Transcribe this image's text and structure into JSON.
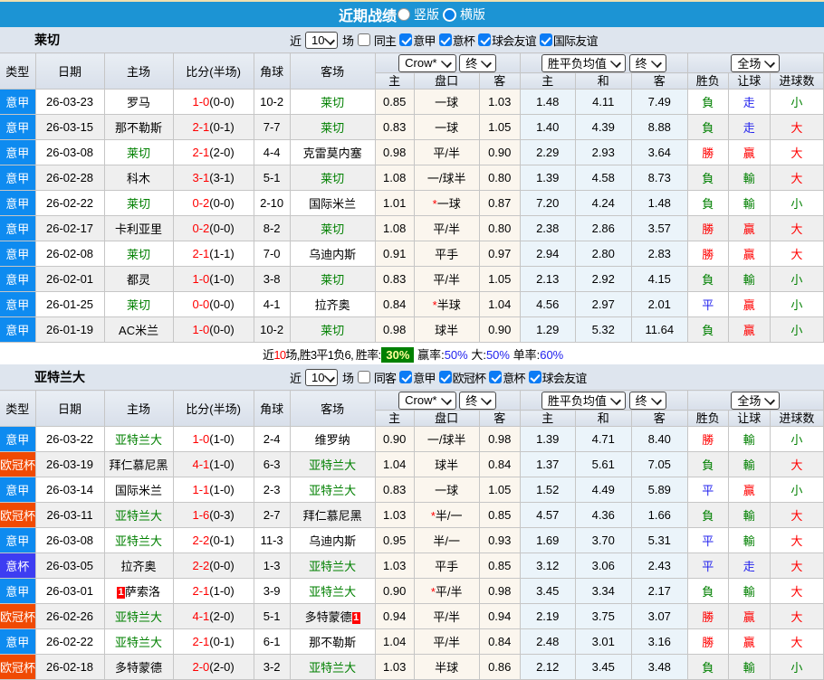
{
  "top_bar": {
    "title": "近期战绩",
    "view_options": [
      {
        "label": "竖版",
        "selected": true
      },
      {
        "label": "横版",
        "selected": false
      }
    ]
  },
  "table_headers": {
    "type": "类型",
    "date": "日期",
    "home": "主场",
    "score": "比分(半场)",
    "corner": "角球",
    "away": "客场",
    "odds_home": "主",
    "handicap": "盘口",
    "odds_away": "客",
    "avg_home": "主",
    "avg_draw": "和",
    "avg_away": "客",
    "result_wdl": "胜负",
    "result_handicap": "让球",
    "result_goals": "进球数"
  },
  "selects": {
    "company": "Crow*",
    "company_final": "终",
    "avg_name": "胜平负均值",
    "avg_final": "终",
    "scope": "全场"
  },
  "filter_labels": {
    "near": "近",
    "games": "场"
  },
  "type_colors": {
    "意甲": "#0E8BF0",
    "欧冠杯": "#F04A03",
    "意杯": "#3D3DF2"
  },
  "result_colors": {
    "勝": "#FF0000",
    "負": "#008000",
    "平": "#2222EE",
    "贏": "#FF0000",
    "輸": "#008000",
    "走": "#2222EE",
    "大": "#FF0000",
    "小": "#008000"
  },
  "sections": [
    {
      "team": "莱切",
      "count": "10",
      "same_label": "同主",
      "same_checked": false,
      "leagues": [
        "意甲",
        "意杯",
        "球会友谊",
        "国际友谊"
      ],
      "rows": [
        {
          "type": "意甲",
          "date": "26-03-23",
          "home": {
            "name": "罗马"
          },
          "score": "1-0",
          "half": "(0-0)",
          "corner": "10-2",
          "away": {
            "name": "莱切",
            "green": true
          },
          "o1": "0.85",
          "hcap": "一球",
          "star": false,
          "o2": "1.03",
          "a1": "1.48",
          "a2": "4.11",
          "a3": "7.49",
          "r1": "負",
          "r2": "走",
          "r3": "小"
        },
        {
          "type": "意甲",
          "date": "26-03-15",
          "home": {
            "name": "那不勒斯"
          },
          "score": "2-1",
          "half": "(0-1)",
          "corner": "7-7",
          "away": {
            "name": "莱切",
            "green": true
          },
          "o1": "0.83",
          "hcap": "一球",
          "star": false,
          "o2": "1.05",
          "a1": "1.40",
          "a2": "4.39",
          "a3": "8.88",
          "r1": "負",
          "r2": "走",
          "r3": "大"
        },
        {
          "type": "意甲",
          "date": "26-03-08",
          "home": {
            "name": "莱切",
            "green": true
          },
          "score": "2-1",
          "half": "(2-0)",
          "corner": "4-4",
          "away": {
            "name": "克雷莫内塞"
          },
          "o1": "0.98",
          "hcap": "平/半",
          "star": false,
          "o2": "0.90",
          "a1": "2.29",
          "a2": "2.93",
          "a3": "3.64",
          "r1": "勝",
          "r2": "贏",
          "r3": "大"
        },
        {
          "type": "意甲",
          "date": "26-02-28",
          "home": {
            "name": "科木"
          },
          "score": "3-1",
          "half": "(3-1)",
          "corner": "5-1",
          "away": {
            "name": "莱切",
            "green": true
          },
          "o1": "1.08",
          "hcap": "一/球半",
          "star": false,
          "o2": "0.80",
          "a1": "1.39",
          "a2": "4.58",
          "a3": "8.73",
          "r1": "負",
          "r2": "輸",
          "r3": "大"
        },
        {
          "type": "意甲",
          "date": "26-02-22",
          "home": {
            "name": "莱切",
            "green": true
          },
          "score": "0-2",
          "half": "(0-0)",
          "corner": "2-10",
          "away": {
            "name": "国际米兰"
          },
          "o1": "1.01",
          "hcap": "一球",
          "star": true,
          "o2": "0.87",
          "a1": "7.20",
          "a2": "4.24",
          "a3": "1.48",
          "r1": "負",
          "r2": "輸",
          "r3": "小"
        },
        {
          "type": "意甲",
          "date": "26-02-17",
          "home": {
            "name": "卡利亚里"
          },
          "score": "0-2",
          "half": "(0-0)",
          "corner": "8-2",
          "away": {
            "name": "莱切",
            "green": true
          },
          "o1": "1.08",
          "hcap": "平/半",
          "star": false,
          "o2": "0.80",
          "a1": "2.38",
          "a2": "2.86",
          "a3": "3.57",
          "r1": "勝",
          "r2": "贏",
          "r3": "大"
        },
        {
          "type": "意甲",
          "date": "26-02-08",
          "home": {
            "name": "莱切",
            "green": true
          },
          "score": "2-1",
          "half": "(1-1)",
          "corner": "7-0",
          "away": {
            "name": "乌迪内斯"
          },
          "o1": "0.91",
          "hcap": "平手",
          "star": false,
          "o2": "0.97",
          "a1": "2.94",
          "a2": "2.80",
          "a3": "2.83",
          "r1": "勝",
          "r2": "贏",
          "r3": "大"
        },
        {
          "type": "意甲",
          "date": "26-02-01",
          "home": {
            "name": "都灵"
          },
          "score": "1-0",
          "half": "(1-0)",
          "corner": "3-8",
          "away": {
            "name": "莱切",
            "green": true
          },
          "o1": "0.83",
          "hcap": "平/半",
          "star": false,
          "o2": "1.05",
          "a1": "2.13",
          "a2": "2.92",
          "a3": "4.15",
          "r1": "負",
          "r2": "輸",
          "r3": "小"
        },
        {
          "type": "意甲",
          "date": "26-01-25",
          "home": {
            "name": "莱切",
            "green": true
          },
          "score": "0-0",
          "half": "(0-0)",
          "corner": "4-1",
          "away": {
            "name": "拉齐奥"
          },
          "o1": "0.84",
          "hcap": "半球",
          "star": true,
          "o2": "1.04",
          "a1": "4.56",
          "a2": "2.97",
          "a3": "2.01",
          "r1": "平",
          "r2": "贏",
          "r3": "小"
        },
        {
          "type": "意甲",
          "date": "26-01-19",
          "home": {
            "name": "AC米兰"
          },
          "score": "1-0",
          "half": "(0-0)",
          "corner": "10-2",
          "away": {
            "name": "莱切",
            "green": true
          },
          "o1": "0.98",
          "hcap": "球半",
          "star": false,
          "o2": "0.90",
          "a1": "1.29",
          "a2": "5.32",
          "a3": "11.64",
          "r1": "負",
          "r2": "贏",
          "r3": "小"
        }
      ],
      "footer": {
        "prefix": "近",
        "count": "10",
        "mid": "场,胜3平1负6, 胜率:",
        "win_pct": "30%",
        "items": [
          {
            "label": "赢率:",
            "value": "50%"
          },
          {
            "label": "大:",
            "value": "50%"
          },
          {
            "label": "单率:",
            "value": "60%"
          }
        ]
      }
    },
    {
      "team": "亚特兰大",
      "count": "10",
      "same_label": "同客",
      "same_checked": false,
      "leagues": [
        "意甲",
        "欧冠杯",
        "意杯",
        "球会友谊"
      ],
      "rows": [
        {
          "type": "意甲",
          "date": "26-03-22",
          "home": {
            "name": "亚特兰大",
            "green": true
          },
          "score": "1-0",
          "half": "(1-0)",
          "corner": "2-4",
          "away": {
            "name": "维罗纳"
          },
          "o1": "0.90",
          "hcap": "一/球半",
          "star": false,
          "o2": "0.98",
          "a1": "1.39",
          "a2": "4.71",
          "a3": "8.40",
          "r1": "勝",
          "r2": "輸",
          "r3": "小"
        },
        {
          "type": "欧冠杯",
          "date": "26-03-19",
          "home": {
            "name": "拜仁慕尼黑"
          },
          "score": "4-1",
          "half": "(1-0)",
          "corner": "6-3",
          "away": {
            "name": "亚特兰大",
            "green": true
          },
          "o1": "1.04",
          "hcap": "球半",
          "star": false,
          "o2": "0.84",
          "a1": "1.37",
          "a2": "5.61",
          "a3": "7.05",
          "r1": "負",
          "r2": "輸",
          "r3": "大"
        },
        {
          "type": "意甲",
          "date": "26-03-14",
          "home": {
            "name": "国际米兰"
          },
          "score": "1-1",
          "half": "(1-0)",
          "corner": "2-3",
          "away": {
            "name": "亚特兰大",
            "green": true
          },
          "o1": "0.83",
          "hcap": "一球",
          "star": false,
          "o2": "1.05",
          "a1": "1.52",
          "a2": "4.49",
          "a3": "5.89",
          "r1": "平",
          "r2": "贏",
          "r3": "小"
        },
        {
          "type": "欧冠杯",
          "date": "26-03-11",
          "home": {
            "name": "亚特兰大",
            "green": true
          },
          "score": "1-6",
          "half": "(0-3)",
          "corner": "2-7",
          "away": {
            "name": "拜仁慕尼黑"
          },
          "o1": "1.03",
          "hcap": "半/一",
          "star": true,
          "o2": "0.85",
          "a1": "4.57",
          "a2": "4.36",
          "a3": "1.66",
          "r1": "負",
          "r2": "輸",
          "r3": "大"
        },
        {
          "type": "意甲",
          "date": "26-03-08",
          "home": {
            "name": "亚特兰大",
            "green": true
          },
          "score": "2-2",
          "half": "(0-1)",
          "corner": "11-3",
          "away": {
            "name": "乌迪内斯"
          },
          "o1": "0.95",
          "hcap": "半/一",
          "star": false,
          "o2": "0.93",
          "a1": "1.69",
          "a2": "3.70",
          "a3": "5.31",
          "r1": "平",
          "r2": "輸",
          "r3": "大"
        },
        {
          "type": "意杯",
          "date": "26-03-05",
          "home": {
            "name": "拉齐奥"
          },
          "score": "2-2",
          "half": "(0-0)",
          "corner": "1-3",
          "away": {
            "name": "亚特兰大",
            "green": true
          },
          "o1": "1.03",
          "hcap": "平手",
          "star": false,
          "o2": "0.85",
          "a1": "3.12",
          "a2": "3.06",
          "a3": "2.43",
          "r1": "平",
          "r2": "走",
          "r3": "大"
        },
        {
          "type": "意甲",
          "date": "26-03-01",
          "home": {
            "name": "萨索洛",
            "card_pre": "1"
          },
          "score": "2-1",
          "half": "(1-0)",
          "corner": "3-9",
          "away": {
            "name": "亚特兰大",
            "green": true
          },
          "o1": "0.90",
          "hcap": "平/半",
          "star": true,
          "o2": "0.98",
          "a1": "3.45",
          "a2": "3.34",
          "a3": "2.17",
          "r1": "負",
          "r2": "輸",
          "r3": "大"
        },
        {
          "type": "欧冠杯",
          "date": "26-02-26",
          "home": {
            "name": "亚特兰大",
            "green": true
          },
          "score": "4-1",
          "half": "(2-0)",
          "corner": "5-1",
          "away": {
            "name": "多特蒙德",
            "card_post": "1"
          },
          "o1": "0.94",
          "hcap": "平/半",
          "star": false,
          "o2": "0.94",
          "a1": "2.19",
          "a2": "3.75",
          "a3": "3.07",
          "r1": "勝",
          "r2": "贏",
          "r3": "大"
        },
        {
          "type": "意甲",
          "date": "26-02-22",
          "home": {
            "name": "亚特兰大",
            "green": true
          },
          "score": "2-1",
          "half": "(0-1)",
          "corner": "6-1",
          "away": {
            "name": "那不勒斯"
          },
          "o1": "1.04",
          "hcap": "平/半",
          "star": false,
          "o2": "0.84",
          "a1": "2.48",
          "a2": "3.01",
          "a3": "3.16",
          "r1": "勝",
          "r2": "贏",
          "r3": "大"
        },
        {
          "type": "欧冠杯",
          "date": "26-02-18",
          "home": {
            "name": "多特蒙德"
          },
          "score": "2-0",
          "half": "(2-0)",
          "corner": "3-2",
          "away": {
            "name": "亚特兰大",
            "green": true
          },
          "o1": "1.03",
          "hcap": "半球",
          "star": false,
          "o2": "0.86",
          "a1": "2.12",
          "a2": "3.45",
          "a3": "3.48",
          "r1": "負",
          "r2": "輸",
          "r3": "小"
        }
      ],
      "footer": null
    }
  ]
}
